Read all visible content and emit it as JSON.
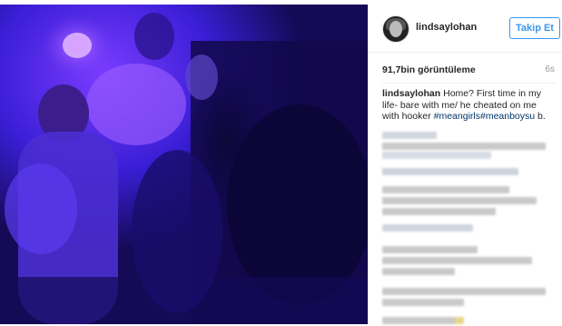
{
  "post": {
    "username": "lindsaylohan",
    "follow_label": "Takip Et",
    "views": "91,7bin görüntüleme",
    "time": "6s",
    "caption_user": "lindsaylohan",
    "caption_text": "Home? First time in my life- bare with me/ he cheated on me with hooker",
    "hashtag_1": "#meangirls",
    "hashtag_2": "#meanboysu",
    "caption_tail": "b."
  },
  "colors": {
    "accent": "#3897f0",
    "hashtag": "#003569",
    "text": "#262626",
    "muted": "#999999",
    "media_bg": "#1a0c6a"
  },
  "icons": {
    "avatar": "profile-avatar"
  }
}
